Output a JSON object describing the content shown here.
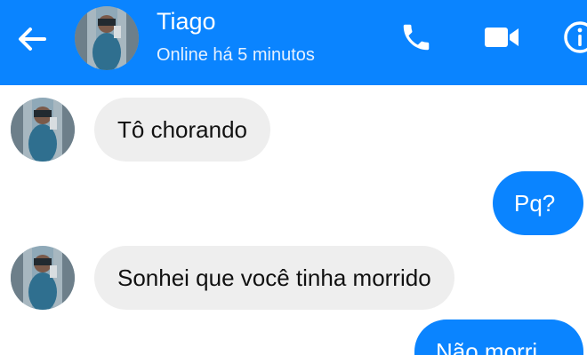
{
  "colors": {
    "header_bg": "#0a84ff",
    "outgoing_bubble": "#0a84ff",
    "incoming_bubble": "#eeeeee",
    "background": "#ffffff"
  },
  "header": {
    "back_icon": "back-arrow-icon",
    "contact_name": "Tiago",
    "status": "Online há 5 minutos",
    "call_icon": "phone-icon",
    "video_icon": "video-camera-icon",
    "info_icon": "info-icon"
  },
  "messages": [
    {
      "direction": "incoming",
      "text": "Tô chorando"
    },
    {
      "direction": "outgoing",
      "text": "Pq?"
    },
    {
      "direction": "incoming",
      "text": "Sonhei que você tinha morrido"
    },
    {
      "direction": "outgoing",
      "text": "Não morri"
    }
  ]
}
